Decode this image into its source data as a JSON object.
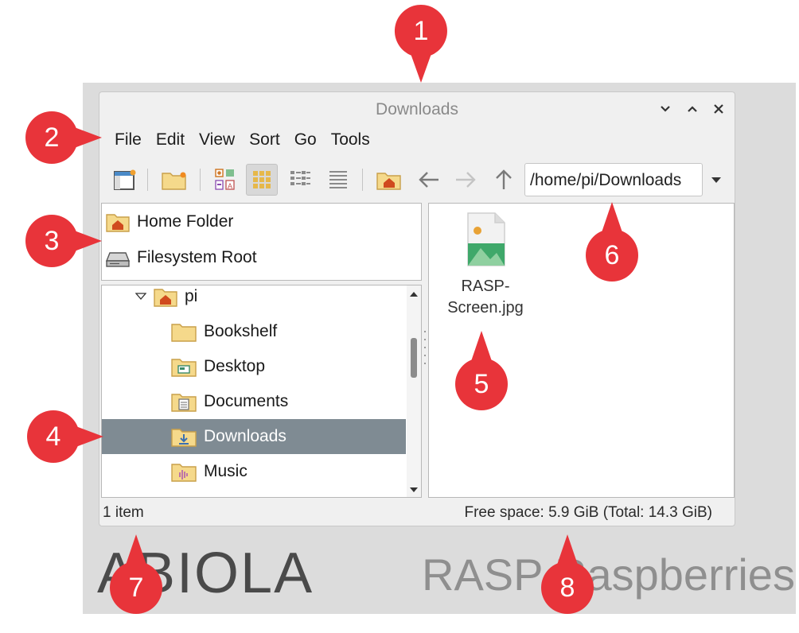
{
  "window": {
    "title": "Downloads",
    "controls": [
      "minimize",
      "maximize",
      "close"
    ]
  },
  "menu": [
    "File",
    "Edit",
    "View",
    "Sort",
    "Go",
    "Tools"
  ],
  "toolbar": {
    "buttons": [
      "new-window-icon",
      "new-folder-icon",
      "icon-view-icon",
      "thumbnail-view-icon",
      "compact-view-icon",
      "detailed-list-icon",
      "home-icon",
      "back-arrow-icon",
      "forward-arrow-icon",
      "up-arrow-icon"
    ],
    "active": "thumbnail-view-icon"
  },
  "path": {
    "value": "/home/pi/Downloads"
  },
  "places": [
    {
      "label": "Home Folder",
      "icon": "home-folder-icon"
    },
    {
      "label": "Filesystem Root",
      "icon": "drive-icon"
    }
  ],
  "tree": [
    {
      "label": "pi",
      "icon": "home-folder-icon",
      "expanded": true
    },
    {
      "label": "Bookshelf",
      "icon": "folder-icon"
    },
    {
      "label": "Desktop",
      "icon": "desktop-folder-icon"
    },
    {
      "label": "Documents",
      "icon": "documents-folder-icon"
    },
    {
      "label": "Downloads",
      "icon": "downloads-folder-icon",
      "selected": true
    },
    {
      "label": "Music",
      "icon": "music-folder-icon"
    }
  ],
  "files": [
    {
      "name": "RASP-Screen.jpg",
      "icon": "image-file-icon"
    }
  ],
  "status": {
    "left": "1 item",
    "right": "Free space: 5.9 GiB (Total: 14.3 GiB)"
  },
  "callouts": [
    "1",
    "2",
    "3",
    "4",
    "5",
    "6",
    "7",
    "8"
  ],
  "watermark": {
    "logo_text": "ABIOLA",
    "tagline": "RASP Raspberries"
  },
  "colors": {
    "callout": "#e8343a",
    "selection": "#7f8b93",
    "folder": "#f5d98b",
    "home_badge": "#d04a1e"
  }
}
